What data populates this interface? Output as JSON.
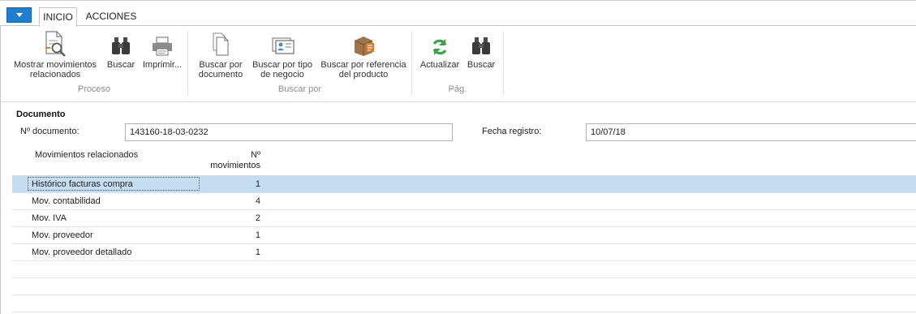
{
  "tabs": {
    "active": "INICIO",
    "other": "ACCIONES"
  },
  "ribbon": {
    "proceso": {
      "label": "Proceso",
      "buttons": {
        "mostrar": "Mostrar movimientos\nrelacionados",
        "buscar": "Buscar",
        "imprimir": "Imprimir..."
      }
    },
    "buscar_por": {
      "label": "Buscar por",
      "buttons": {
        "documento": "Buscar por\ndocumento",
        "tipo_negocio": "Buscar por tipo\nde negocio",
        "ref_producto": "Buscar por referencia\ndel producto"
      }
    },
    "pag": {
      "label": "Pág.",
      "buttons": {
        "actualizar": "Actualizar",
        "buscar": "Buscar"
      }
    }
  },
  "documento": {
    "title": "Documento",
    "nro_label": "Nº documento:",
    "nro_value": "143160-18-03-0232",
    "fecha_label": "Fecha registro:",
    "fecha_value": "10/07/18"
  },
  "grid": {
    "headers": {
      "movimientos": "Movimientos relacionados",
      "count": "Nº\nmovimientos"
    },
    "rows": [
      {
        "name": "Histórico facturas compra",
        "count": "1"
      },
      {
        "name": "Mov. contabilidad",
        "count": "4"
      },
      {
        "name": "Mov. IVA",
        "count": "2"
      },
      {
        "name": "Mov. proveedor",
        "count": "1"
      },
      {
        "name": "Mov. proveedor detallado",
        "count": "1"
      }
    ]
  },
  "colors": {
    "accent": "#1e7ed2",
    "selected_row": "#c5ddf2",
    "refresh_green": "#3aa547"
  },
  "icons": [
    "dropdown-arrow-icon",
    "document-magnifier-icon",
    "binoculars-icon",
    "printer-icon",
    "documents-icon",
    "business-card-icon",
    "product-box-icon",
    "refresh-icon"
  ]
}
